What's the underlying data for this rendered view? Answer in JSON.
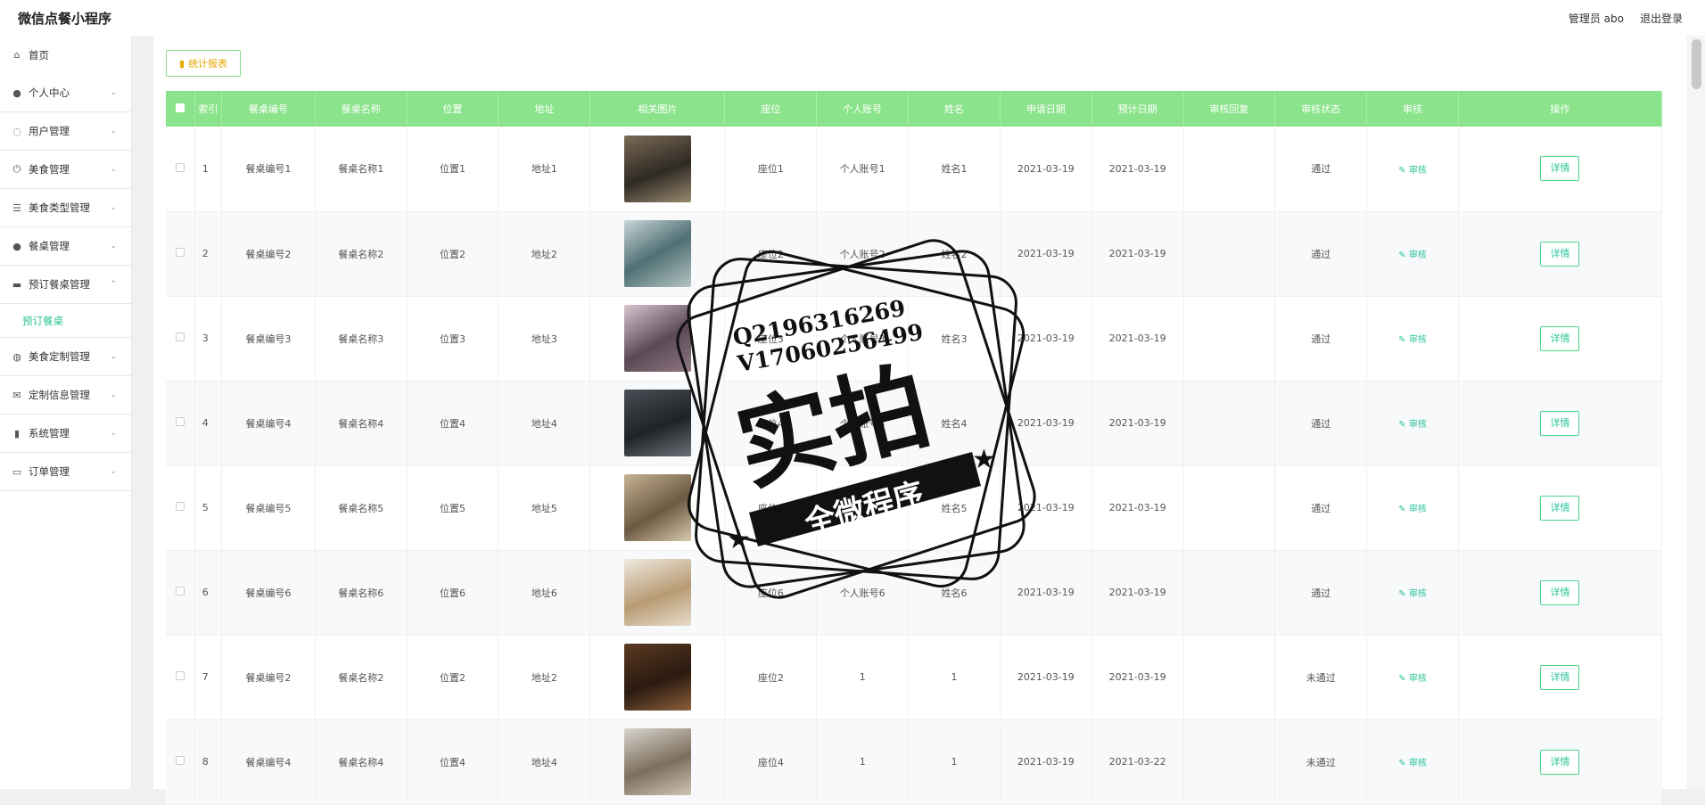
{
  "header": {
    "title": "微信点餐小程序",
    "admin": "管理员 abo",
    "logout": "退出登录"
  },
  "sidebar": {
    "items": [
      {
        "label": "首页",
        "icon": "home-icon",
        "glyph": "⌂",
        "expand": ""
      },
      {
        "label": "个人中心",
        "icon": "user-icon",
        "glyph": "●",
        "expand": "⌄"
      },
      {
        "label": "用户管理",
        "icon": "bell-icon",
        "glyph": "◌",
        "expand": "⌄"
      },
      {
        "label": "美食管理",
        "icon": "power-icon",
        "glyph": "⏻",
        "expand": "⌄"
      },
      {
        "label": "美食类型管理",
        "icon": "list-icon",
        "glyph": "☰",
        "expand": "⌄"
      },
      {
        "label": "餐桌管理",
        "icon": "person-icon",
        "glyph": "●",
        "expand": "⌄"
      },
      {
        "label": "预订餐桌管理",
        "icon": "monitor-icon",
        "glyph": "▬",
        "expand": "⌃"
      },
      {
        "label": "美食定制管理",
        "icon": "globe-icon",
        "glyph": "◍",
        "expand": "⌄"
      },
      {
        "label": "定制信息管理",
        "icon": "mail-icon",
        "glyph": "✉",
        "expand": "⌄"
      },
      {
        "label": "系统管理",
        "icon": "bar-chart-icon",
        "glyph": "▮",
        "expand": "⌄"
      },
      {
        "label": "订单管理",
        "icon": "chat-icon",
        "glyph": "▭",
        "expand": "⌄"
      }
    ],
    "sub_item": "预订餐桌"
  },
  "toolbar": {
    "stats_label": "统计报表"
  },
  "table": {
    "columns": [
      "",
      "索引",
      "餐桌编号",
      "餐桌名称",
      "位置",
      "地址",
      "相关图片",
      "座位",
      "个人账号",
      "姓名",
      "申请日期",
      "预计日期",
      "审核回复",
      "审核状态",
      "审核",
      "操作"
    ],
    "audit_label": "审核",
    "detail_label": "详情",
    "rows": [
      {
        "idx": "1",
        "code": "餐桌编号1",
        "name": "餐桌名称1",
        "pos": "位置1",
        "addr": "地址1",
        "seat": "座位1",
        "account": "个人账号1",
        "person": "姓名1",
        "apply": "2021-03-19",
        "expect": "2021-03-19",
        "reply": "",
        "status": "通过"
      },
      {
        "idx": "2",
        "code": "餐桌编号2",
        "name": "餐桌名称2",
        "pos": "位置2",
        "addr": "地址2",
        "seat": "座位2",
        "account": "个人账号2",
        "person": "姓名2",
        "apply": "2021-03-19",
        "expect": "2021-03-19",
        "reply": "",
        "status": "通过"
      },
      {
        "idx": "3",
        "code": "餐桌编号3",
        "name": "餐桌名称3",
        "pos": "位置3",
        "addr": "地址3",
        "seat": "座位3",
        "account": "个人账号3",
        "person": "姓名3",
        "apply": "2021-03-19",
        "expect": "2021-03-19",
        "reply": "",
        "status": "通过"
      },
      {
        "idx": "4",
        "code": "餐桌编号4",
        "name": "餐桌名称4",
        "pos": "位置4",
        "addr": "地址4",
        "seat": "座位4",
        "account": "个人账号4",
        "person": "姓名4",
        "apply": "2021-03-19",
        "expect": "2021-03-19",
        "reply": "",
        "status": "通过"
      },
      {
        "idx": "5",
        "code": "餐桌编号5",
        "name": "餐桌名称5",
        "pos": "位置5",
        "addr": "地址5",
        "seat": "座位5",
        "account": "个人账号5",
        "person": "姓名5",
        "apply": "2021-03-19",
        "expect": "2021-03-19",
        "reply": "",
        "status": "通过"
      },
      {
        "idx": "6",
        "code": "餐桌编号6",
        "name": "餐桌名称6",
        "pos": "位置6",
        "addr": "地址6",
        "seat": "座位6",
        "account": "个人账号6",
        "person": "姓名6",
        "apply": "2021-03-19",
        "expect": "2021-03-19",
        "reply": "",
        "status": "通过"
      },
      {
        "idx": "7",
        "code": "餐桌编号2",
        "name": "餐桌名称2",
        "pos": "位置2",
        "addr": "地址2",
        "seat": "座位2",
        "account": "1",
        "person": "1",
        "apply": "2021-03-19",
        "expect": "2021-03-19",
        "reply": "",
        "status": "未通过"
      },
      {
        "idx": "8",
        "code": "餐桌编号4",
        "name": "餐桌名称4",
        "pos": "位置4",
        "addr": "地址4",
        "seat": "座位4",
        "account": "1",
        "person": "1",
        "apply": "2021-03-19",
        "expect": "2021-03-22",
        "reply": "",
        "status": "未通过"
      }
    ]
  },
  "watermark": {
    "line1": "Q2196316269",
    "line2": "V17060256499",
    "main": "实拍",
    "banner": "全微程序"
  },
  "colors": {
    "header_green": "#8be48b",
    "accent_green": "#2ec49a",
    "stats_yellow": "#e6a700"
  }
}
